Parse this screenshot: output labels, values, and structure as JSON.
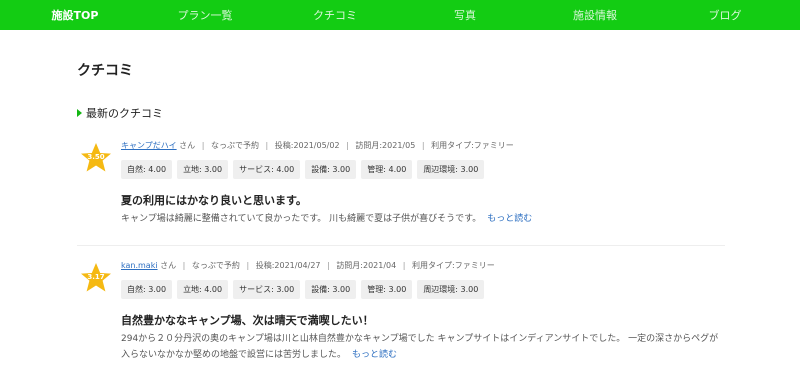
{
  "nav": {
    "items": [
      "施設TOP",
      "プラン一覧",
      "クチコミ",
      "写真",
      "施設情報",
      "ブログ"
    ],
    "active_index": 0
  },
  "page_title": "クチコミ",
  "section_title": "最新のクチコミ",
  "colors": {
    "nav_bg": "#13cc13",
    "star": "#f5b912",
    "link": "#2d6fc1"
  },
  "reviews": [
    {
      "score": "3.50",
      "author": "キャンプだハイ",
      "honorific": "さん",
      "booking": "なっぷで予約",
      "posted": "投稿:2021/05/02",
      "visited": "訪問月:2021/05",
      "usage_type": "利用タイプ:ファミリー",
      "ratings": [
        "自然: 4.00",
        "立地: 3.00",
        "サービス: 4.00",
        "設備: 3.00",
        "管理: 4.00",
        "周辺環境: 3.00"
      ],
      "headline": "夏の利用にはかなり良いと思います。",
      "body": "キャンプ場は綺麗に整備されていて良かったです。 川も綺麗で夏は子供が喜びそうです。",
      "more": "もっと読む"
    },
    {
      "score": "3.17",
      "author": "kan.maki",
      "honorific": "さん",
      "booking": "なっぷで予約",
      "posted": "投稿:2021/04/27",
      "visited": "訪問月:2021/04",
      "usage_type": "利用タイプ:ファミリー",
      "ratings": [
        "自然: 3.00",
        "立地: 4.00",
        "サービス: 3.00",
        "設備: 3.00",
        "管理: 3.00",
        "周辺環境: 3.00"
      ],
      "headline": "自然豊かななキャンプ場、次は晴天で満喫したい！",
      "body": "294から２０分丹沢の奥のキャンプ場は川と山林自然豊かなキャンプ場でした キャンプサイトはインディアンサイトでした。 一定の深さからペグが入らないなかなか堅めの地盤で設営には苦労しました。",
      "more": "もっと読む"
    }
  ]
}
